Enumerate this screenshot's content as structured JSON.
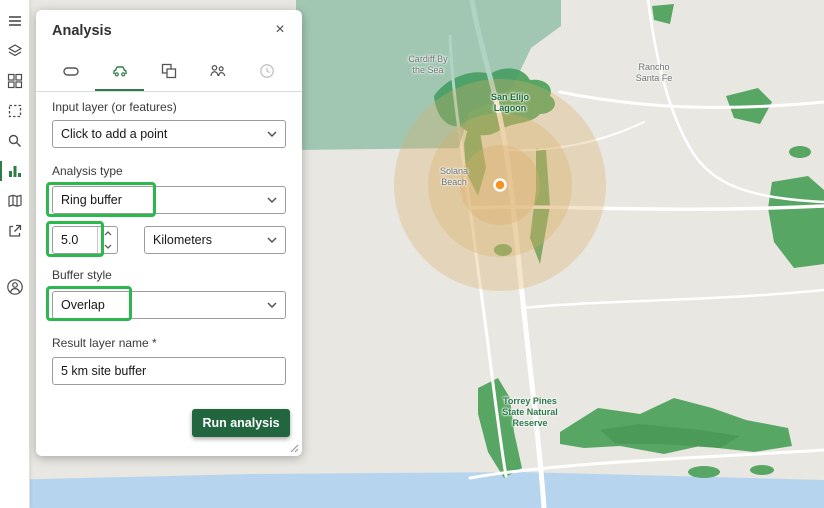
{
  "panel": {
    "title": "Analysis",
    "close": "×",
    "tabs": [
      "measure",
      "drive-time",
      "overlay",
      "demographics",
      "history"
    ],
    "active_tab": "drive-time",
    "input_layer": {
      "label": "Input layer (or features)",
      "value": "Click to add a point"
    },
    "analysis_type": {
      "label": "Analysis type",
      "value": "Ring buffer"
    },
    "distance": {
      "value": "5.0",
      "units": "Kilometers"
    },
    "buffer_style": {
      "label": "Buffer style",
      "value": "Overlap"
    },
    "result_layer": {
      "label": "Result layer name *",
      "value": "5 km site buffer"
    },
    "run_label": "Run analysis"
  },
  "toolbar": {
    "items": [
      "menu",
      "layers",
      "basemap",
      "extent",
      "search",
      "charts",
      "map",
      "share",
      "account"
    ],
    "active": "charts"
  },
  "map": {
    "labels": {
      "cardiff": "Cardiff By\nthe Sea",
      "san_elijo": "San Elijo\nLagoon",
      "rancho": "Rancho\nSanta Fe",
      "solana": "Solana\nBeach",
      "torrey": "Torrey Pines\nState Natural\nReserve"
    }
  },
  "colors": {
    "accent_green": "#2e7d46",
    "annotation_green": "#2db84d",
    "run_button_green": "#21663f",
    "park_green": "#58a663",
    "ring_tan": "#dbae66",
    "water_blue": "#b7d4ee",
    "point_orange": "#f5941f"
  }
}
